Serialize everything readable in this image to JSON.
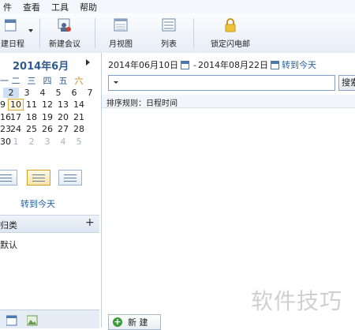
{
  "menu": [
    "件",
    "查看",
    "工具",
    "帮助"
  ],
  "toolbar": {
    "new_schedule": "建日程",
    "new_meeting": "新建会议",
    "month_view": "月视图",
    "list": "列表",
    "lock_email": "锁定闪电邮"
  },
  "calendar": {
    "title": "2014年6月",
    "weekdays": [
      "一",
      "二",
      "三",
      "四",
      "五",
      "六"
    ],
    "weeks": [
      [
        "",
        "2",
        "3",
        "4",
        "5",
        "6",
        "7"
      ],
      [
        "9",
        "10",
        "11",
        "12",
        "13",
        "14"
      ],
      [
        "16",
        "17",
        "18",
        "19",
        "20",
        "21"
      ],
      [
        "23",
        "24",
        "25",
        "26",
        "27",
        "28"
      ],
      [
        "30",
        "1",
        "2",
        "3",
        "4",
        "5"
      ]
    ],
    "goto_today": "转到今天"
  },
  "category": {
    "header": "归类",
    "add": "+",
    "items": [
      "默认"
    ]
  },
  "range": {
    "start": "2014年06月10日",
    "separator": "-",
    "end": "2014年08月22日",
    "goto_today": "转到今天"
  },
  "search": {
    "placeholder": "",
    "button": "搜索"
  },
  "sort_rule": "排序规则：日程时间",
  "new_button": "新 建",
  "watermark": "软件技巧",
  "colors": {
    "accent": "#2660a8",
    "today_border": "#e1a93a",
    "selected": "#cfe0f4"
  }
}
